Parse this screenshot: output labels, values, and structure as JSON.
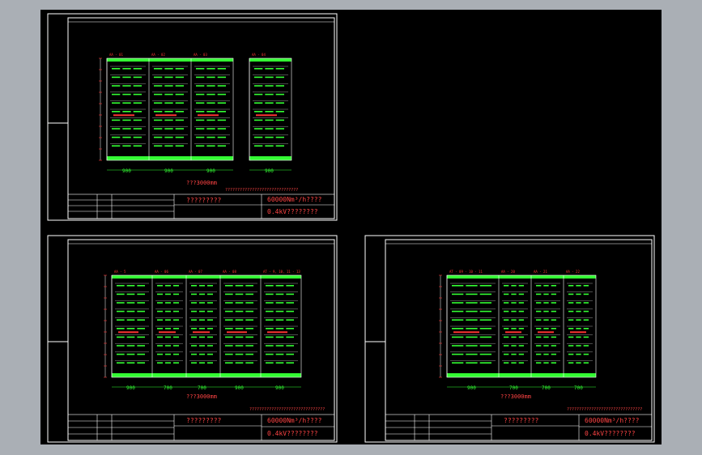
{
  "sheets": [
    {
      "id": "sheet-top-left",
      "cabinet_ids": [
        "AA - 01",
        "AA - 02",
        "AA - 03",
        "AA - 04"
      ],
      "widths": [
        "900",
        "900",
        "900",
        "900"
      ],
      "total": "???3000mm",
      "note": "??????????????????????????????",
      "title_mid": "?????????",
      "title_right_1": "60000Nm³/h????",
      "title_right_2": "0.4kV????????"
    },
    {
      "id": "sheet-bottom-left",
      "cabinet_ids": [
        "AA - 5",
        "AA - 06",
        "AA - 07",
        "AA - 08",
        "AT - 9, 10, 11 - 13"
      ],
      "widths": [
        "900",
        "700",
        "700",
        "900",
        "900"
      ],
      "total": "???3000mm",
      "note": "???????????????????????????????",
      "title_mid": "?????????",
      "title_right_1": "60000Nm³/h????",
      "title_right_2": "0.4kV????????"
    },
    {
      "id": "sheet-bottom-right",
      "cabinet_ids": [
        "AT - 09 - 10 - 11",
        "AA - 20",
        "AA - 21",
        "AA - 22"
      ],
      "widths": [
        "900",
        "700",
        "700",
        "700"
      ],
      "total": "???3000mm",
      "note": "???????????????????????????????",
      "title_mid": "?????????",
      "title_right_1": "60000Nm³/h????",
      "title_right_2": "0.4kV????????"
    }
  ],
  "colors": {
    "background": "#000000",
    "frame": "#ffffff",
    "busbar": "#33ff33",
    "dim": "#33ff33",
    "label": "#ff3333",
    "tag": "#ff4444"
  }
}
